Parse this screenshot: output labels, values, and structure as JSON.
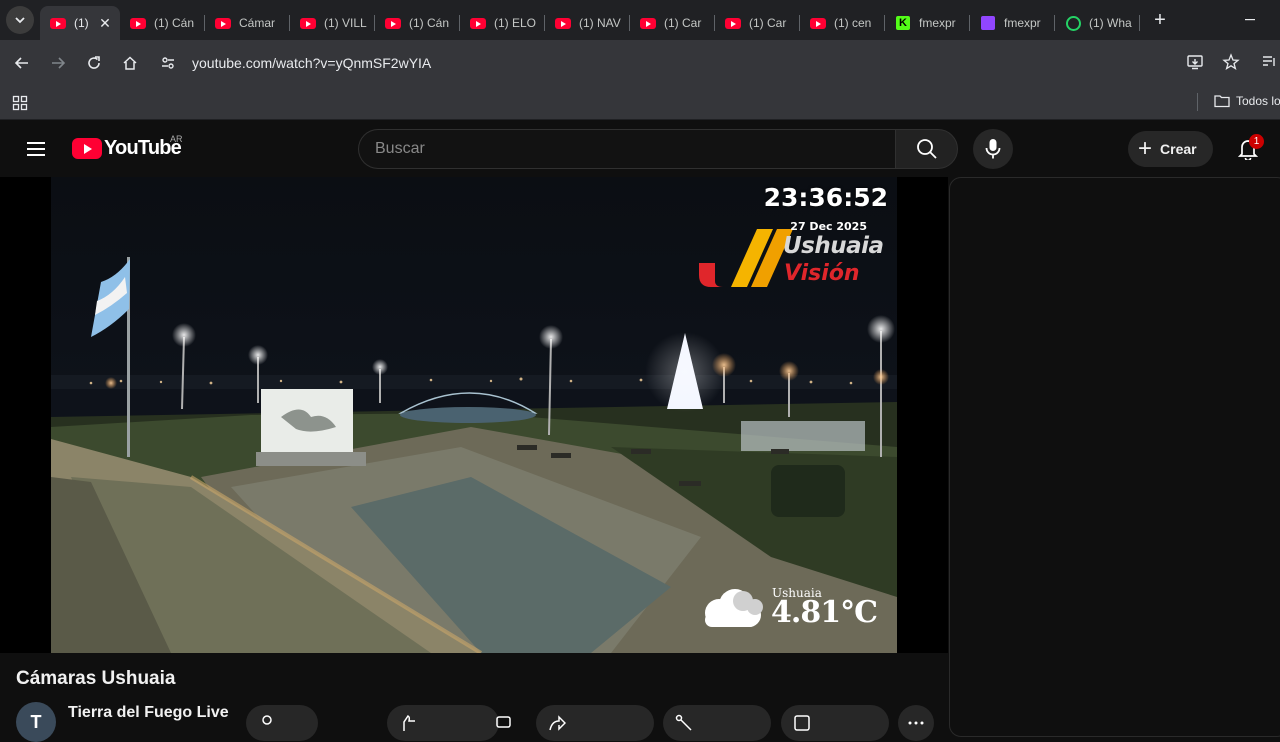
{
  "browser": {
    "tabs": [
      {
        "title": "(1)",
        "favicon": "youtube-icon",
        "active": true
      },
      {
        "title": "(1) Cán",
        "favicon": "youtube-icon"
      },
      {
        "title": "Cámar",
        "favicon": "youtube-icon"
      },
      {
        "title": "(1) VILL",
        "favicon": "youtube-icon"
      },
      {
        "title": "(1) Cán",
        "favicon": "youtube-icon"
      },
      {
        "title": "(1) ELO",
        "favicon": "youtube-icon"
      },
      {
        "title": "(1) NAV",
        "favicon": "youtube-icon"
      },
      {
        "title": "(1) Car",
        "favicon": "youtube-icon"
      },
      {
        "title": "(1) Car",
        "favicon": "youtube-icon"
      },
      {
        "title": "(1) cen",
        "favicon": "youtube-icon"
      },
      {
        "title": "fmexpr",
        "favicon": "kick-icon"
      },
      {
        "title": "fmexpr",
        "favicon": "twitch-icon"
      },
      {
        "title": "(1) Wha",
        "favicon": "whatsapp-icon"
      }
    ],
    "url": "youtube.com/watch?v=yQnmSF2wYIA",
    "bookmarks": {
      "all_label": "Todos lo"
    }
  },
  "youtube": {
    "logo_text": "YouTube",
    "country_code": "AR",
    "search_placeholder": "Buscar",
    "create_label": "Crear",
    "notification_count": "1",
    "brand_color": "#ff0033"
  },
  "video": {
    "overlay_time": "23:36:52",
    "overlay_date": "27 Dec 2025",
    "overlay_brand_line1": "Ushuaia",
    "overlay_brand_line2": "Visión",
    "overlay_city": "Ushuaia",
    "overlay_temp": "4.81°C",
    "title": "Cámaras Ushuaia",
    "channel": "Tierra del Fuego Live",
    "avatar_letter": "T"
  }
}
